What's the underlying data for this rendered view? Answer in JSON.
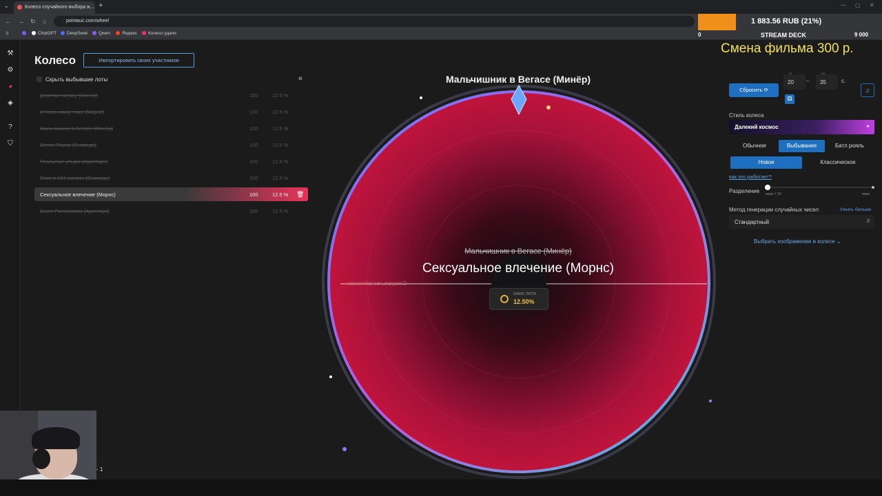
{
  "browser": {
    "tab_title": "Колесо случайного выбора - ...",
    "url": "pointauc.com/wheel",
    "bookmarks": [
      {
        "label": "ChatGPT",
        "color": "#ffffff"
      },
      {
        "label": "DeepSeek",
        "color": "#4d6bfe"
      },
      {
        "label": "Qwen",
        "color": "#8a5cf6"
      },
      {
        "label": "Яндекс",
        "color": "#fc3f1d"
      },
      {
        "label": "Колесо удачи",
        "color": "#e8335a"
      }
    ]
  },
  "overlay": {
    "money": "1 883.56 RUB (21%)",
    "title": "STREAM DECK",
    "min": "0",
    "max": "9 000",
    "progress_fraction": 0.21,
    "caption": "Смена фильма 300 р."
  },
  "page": {
    "title": "Колесо",
    "import_button": "Импортировать своих участников",
    "hide_dropped": "Скрыть выбывшие лоты",
    "collapse": "«"
  },
  "participants": [
    {
      "name": "Девочки сверху (Минёр)",
      "amount": "100",
      "percent": "12.5 %",
      "dropped": true
    },
    {
      "name": "И твою маму тоже (Морнс)",
      "amount": "100",
      "percent": "12.5 %",
      "dropped": true
    },
    {
      "name": "Мальчишник в Вегасе (Минёр)",
      "amount": "100",
      "percent": "12.5 %",
      "dropped": true
    },
    {
      "name": "Остин Пауэр (Сноведи)",
      "amount": "100",
      "percent": "12.5 %",
      "dropped": true
    },
    {
      "name": "Реальные упыри (Аристарх)",
      "amount": "100",
      "percent": "12.5 %",
      "dropped": true
    },
    {
      "name": "Секс и 101 смерть (Сноведи)",
      "amount": "100",
      "percent": "12.5 %",
      "dropped": true
    },
    {
      "name": "Сексуальное влечение (Морнс)",
      "amount": "100",
      "percent": "12.5 %",
      "dropped": false
    },
    {
      "name": "Скотт Пилигримм (Аристарх)",
      "amount": "100",
      "percent": "12.5 %",
      "dropped": true
    }
  ],
  "wheel": {
    "top_winner": "Мальчишник в Вегасе (Минёр)",
    "prev_winner": "Мальчишник в Вегасе (Минёр)",
    "current": "Сексуальное влечение (Морнс)",
    "mirror_text": "Сексуальное влечение",
    "chance_label": "ШАНС ЛОТА",
    "chance_value": "12.50%",
    "color": "#c0143c"
  },
  "controls": {
    "reset_button": "Сбросить",
    "from_label": "от",
    "to_label": "до",
    "from_value": "20",
    "to_value": "35",
    "unit": "с.",
    "wheel_style_label": "Стиль колеса",
    "wheel_style_value": "Далекий космос",
    "modes": [
      "Обычное",
      "Выбывание",
      "Батл рояль"
    ],
    "active_mode": "Выбывание",
    "submodes": [
      "Новое",
      "Классическое"
    ],
    "active_submode": "Новое",
    "how_link": "как это работает?",
    "split_label": "Разделение",
    "split_min": "макс / 10",
    "split_max": "макс",
    "rng_label": "Метод генерации случайных чисел",
    "rng_more": "Узнать больше",
    "rng_value": "Стандартный",
    "image_link": "Выбрать изображение в колесе"
  },
  "webcam": {
    "label": "- 1"
  }
}
